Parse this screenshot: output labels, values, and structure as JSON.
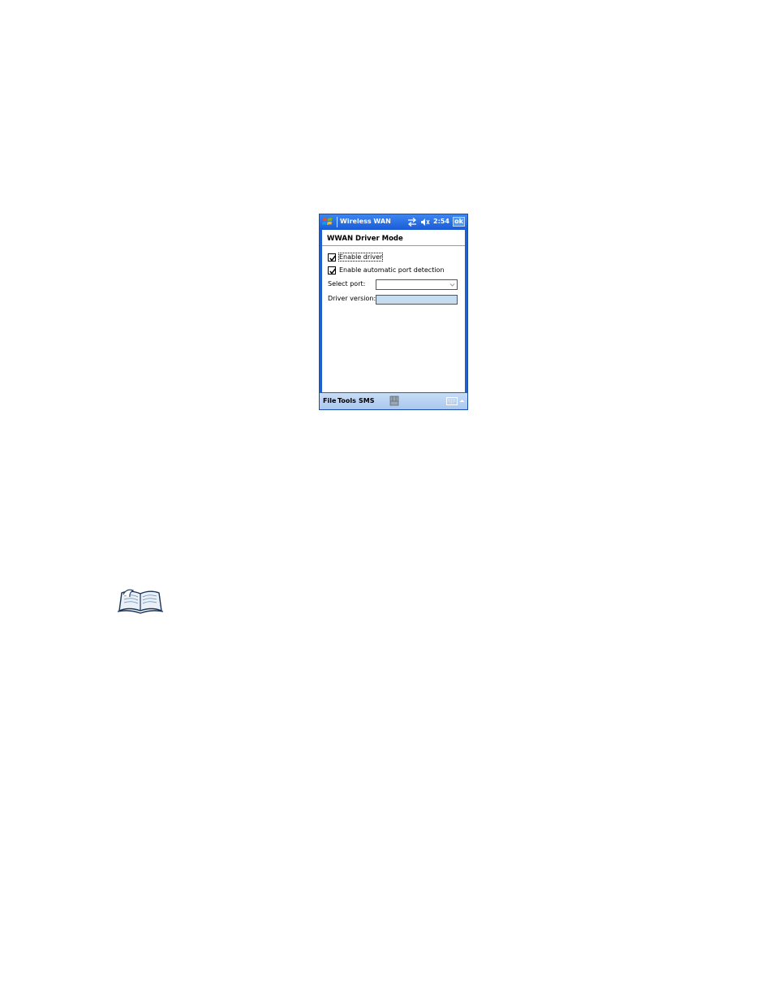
{
  "window": {
    "title": "Wireless WAN",
    "clock": "2:54",
    "ok_label": "ok"
  },
  "page": {
    "title": "WWAN Driver Mode"
  },
  "options": {
    "enable_driver": {
      "label": "Enable driver",
      "checked": true
    },
    "auto_port": {
      "label": "Enable automatic port detection",
      "checked": true
    }
  },
  "fields": {
    "select_port": {
      "label": "Select port:",
      "value": ""
    },
    "driver_version": {
      "label": "Driver version:",
      "value": ""
    }
  },
  "menubar": {
    "file": "File",
    "tools": "Tools",
    "sms": "SMS"
  },
  "icons": {
    "start": "windows-flag-icon",
    "connectivity": "connectivity-arrows-icon",
    "volume": "speaker-muted-icon",
    "sip": "input-panel-icon",
    "keyboard": "keyboard-icon",
    "note": "open-book-icon"
  },
  "colors": {
    "titlebar": "#1a5bd6",
    "menubar": "#b8d2f2",
    "version_field": "#c6dcf1"
  }
}
